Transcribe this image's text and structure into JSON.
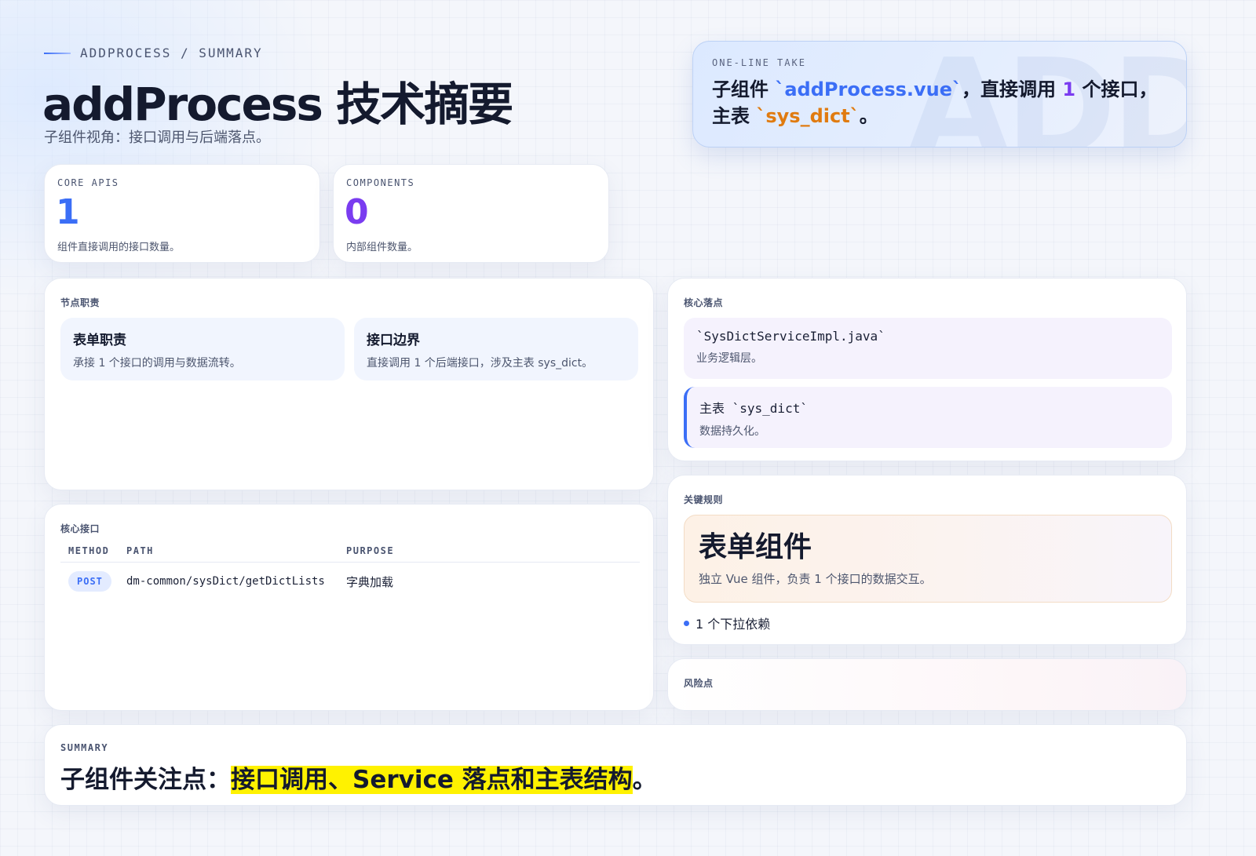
{
  "header": {
    "eyebrow": "ADDPROCESS / SUMMARY",
    "title": "addProcess 技术摘要",
    "subtitle": "子组件视角：接口调用与后端落点。"
  },
  "take": {
    "watermark": "ADD",
    "label": "ONE-LINE TAKE",
    "t1": "子组件 ",
    "component": "`addProcess.vue`",
    "t2": "，直接调用 ",
    "count": "1",
    "t3": " 个接口，主表 ",
    "table": "`sys_dict`",
    "t4": "。"
  },
  "stats": [
    {
      "label": "CORE APIS",
      "value": "1",
      "desc": "组件直接调用的接口数量。",
      "color": "#3b6ef6"
    },
    {
      "label": "COMPONENTS",
      "value": "0",
      "desc": "内部组件数量。",
      "color": "#7a3cf0"
    }
  ],
  "duties": {
    "label": "节点职责",
    "items": [
      {
        "title": "表单职责",
        "desc": "承接 1 个接口的调用与数据流转。"
      },
      {
        "title": "接口边界",
        "desc": "直接调用 1 个后端接口，涉及主表 sys_dict。"
      }
    ]
  },
  "landing": {
    "label": "核心落点",
    "items": [
      {
        "title": "`SysDictServiceImpl.java`",
        "desc": "业务逻辑层。"
      },
      {
        "title": "主表 `sys_dict`",
        "desc": "数据持久化。"
      }
    ]
  },
  "apis": {
    "label": "核心接口",
    "columns": [
      "METHOD",
      "PATH",
      "PURPOSE"
    ],
    "rows": [
      {
        "method": "POST",
        "path": "dm-common/sysDict/getDictLists",
        "purpose": "字典加载"
      }
    ]
  },
  "rules": {
    "label": "关键规则",
    "hero_title": "表单组件",
    "hero_desc": "独立 Vue 组件，负责 1 个接口的数据交互。",
    "bullet": "1 个下拉依赖"
  },
  "risk": {
    "label": "风险点"
  },
  "summary": {
    "label": "SUMMARY",
    "prefix": "子组件关注点：",
    "highlight": "接口调用、Service 落点和主表结构",
    "suffix": "。"
  }
}
